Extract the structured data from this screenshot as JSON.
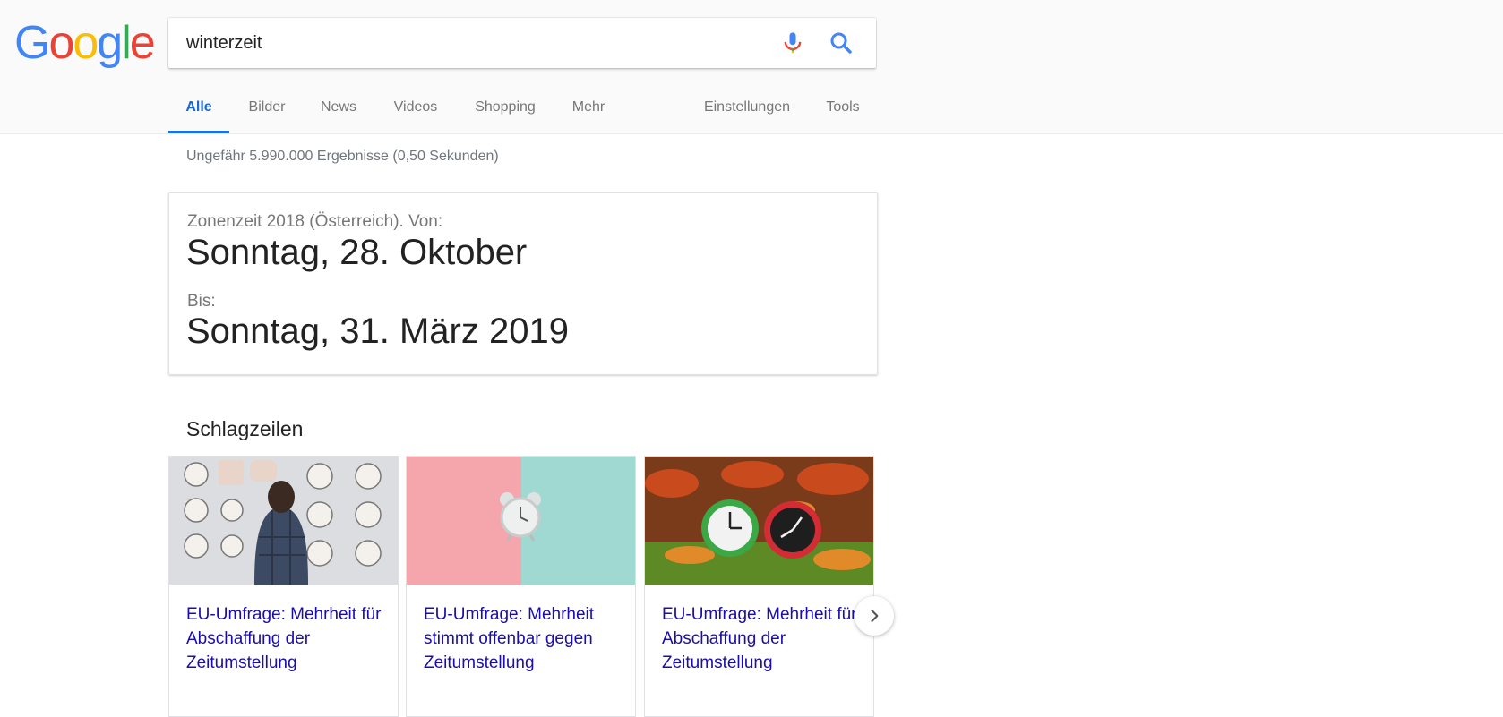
{
  "logo": {
    "letters": [
      "G",
      "o",
      "o",
      "g",
      "l",
      "e"
    ],
    "colors": [
      "#4285f4",
      "#ea4335",
      "#fbbc05",
      "#4285f4",
      "#34a853",
      "#ea4335"
    ]
  },
  "search": {
    "query": "winterzeit"
  },
  "tabs": [
    {
      "label": "Alle",
      "active": true
    },
    {
      "label": "Bilder"
    },
    {
      "label": "News"
    },
    {
      "label": "Videos"
    },
    {
      "label": "Shopping"
    },
    {
      "label": "Mehr"
    },
    {
      "label": "Einstellungen"
    },
    {
      "label": "Tools"
    }
  ],
  "results_stats": "Ungefähr 5.990.000 Ergebnisse (0,50 Sekunden)",
  "answer_card": {
    "from_label": "Zonenzeit 2018 (Österreich). Von:",
    "from_date": "Sonntag, 28. Oktober",
    "to_label": "Bis:",
    "to_date": "Sonntag, 31. März 2019"
  },
  "headlines": {
    "title": "Schlagzeilen",
    "items": [
      {
        "title": "EU-Umfrage: Mehrheit für Abschaffung der Zeitumstellung",
        "image": "clock-wall-image"
      },
      {
        "title": "EU-Umfrage: Mehrheit stimmt offenbar gegen Zeitumstellung",
        "image": "alarm-clock-pastel-image"
      },
      {
        "title": "EU-Umfrage: Mehrheit für Abschaffung der Zeitumstellung",
        "image": "clocks-autumn-leaves-image"
      }
    ]
  },
  "colors": {
    "accent": "#1a73e8",
    "link": "#1a0dab",
    "muted": "#70757a"
  }
}
